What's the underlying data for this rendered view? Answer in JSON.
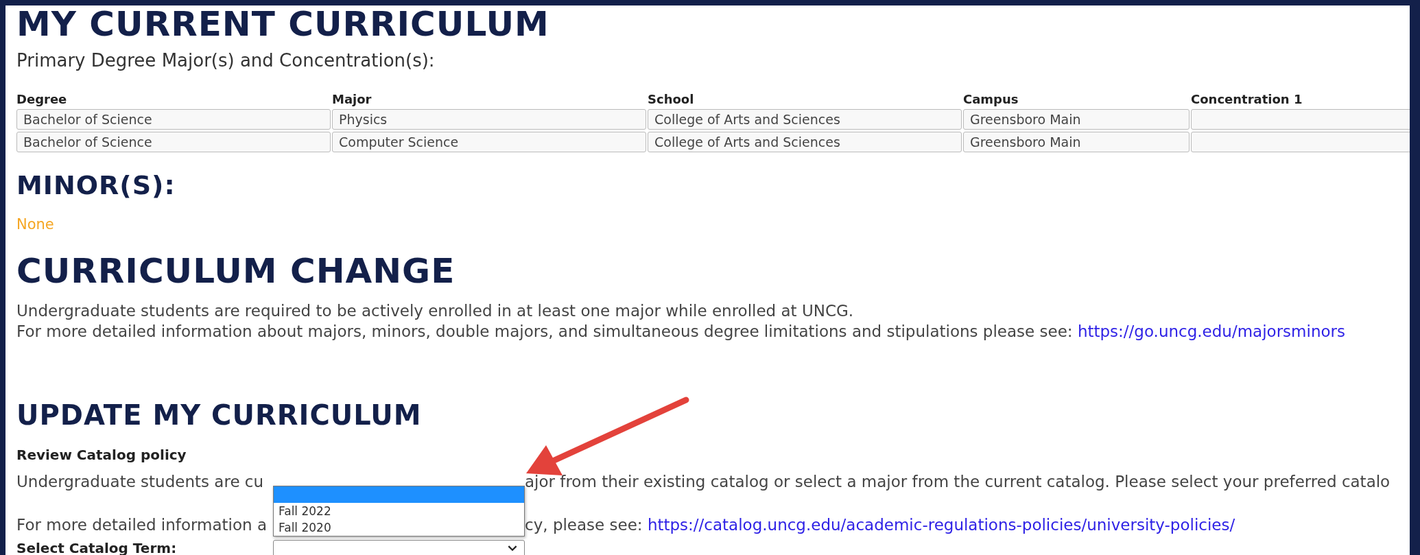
{
  "current": {
    "title": "MY CURRENT CURRICULUM",
    "subtitle": "Primary Degree Major(s) and Concentration(s):",
    "columns": [
      "Degree",
      "Major",
      "School",
      "Campus",
      "Concentration 1"
    ],
    "rows": [
      [
        "Bachelor of Science",
        "Physics",
        "College of Arts and Sciences",
        "Greensboro Main",
        null
      ],
      [
        "Bachelor of Science",
        "Computer Science",
        "College of Arts and Sciences",
        "Greensboro Main",
        null
      ]
    ]
  },
  "minors": {
    "title": "MINOR(S):",
    "value": "None"
  },
  "change": {
    "title": "CURRICULUM CHANGE",
    "line_1": "Undergraduate students are required to be actively enrolled in at least one major while enrolled at UNCG.",
    "line_2": "For more detailed information about majors, minors, double majors, and simultaneous degree limitations and stipulations please see:",
    "link": "https://go.uncg.edu/majorsminors"
  },
  "update": {
    "title": "UPDATE MY CURRICULUM",
    "subheading": "Review Catalog policy",
    "policy_line_start": "Undergraduate students are cu",
    "policy_line_end": "ajor from their existing catalog or select a major from the current catalog. Please select your preferred catalo",
    "info_line_start": "For more detailed information a",
    "info_line_end": "cy, please see:",
    "info_link": "https://catalog.uncg.edu/academic-regulations-policies/university-policies/",
    "term_label": "Select Catalog Term:",
    "term_options": [
      {
        "kind": "blank",
        "selected": true
      },
      {
        "kind": "term",
        "label": "Fall 2022",
        "selected": false
      },
      {
        "kind": "term",
        "label": "Fall 2020",
        "selected": false
      }
    ]
  }
}
